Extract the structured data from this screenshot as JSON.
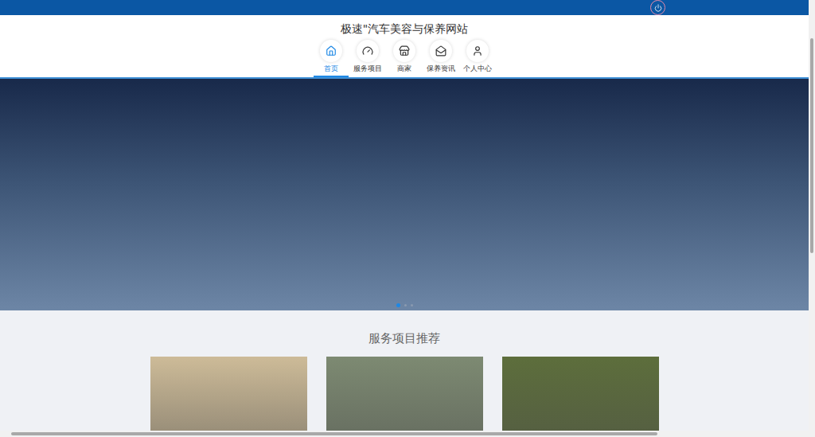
{
  "window": {
    "title": "极速\"汽车美容与保养网站"
  },
  "top_bar": {
    "logout": {
      "kind": "power"
    }
  },
  "nav": [
    {
      "label": "首页",
      "icon": "home",
      "selected": true
    },
    {
      "label": "服务项目",
      "icon": "gauge",
      "selected": false
    },
    {
      "label": "商家",
      "icon": "store",
      "selected": false
    },
    {
      "label": "保养资讯",
      "icon": "mail",
      "selected": false
    },
    {
      "label": "个人中心",
      "icon": "user",
      "selected": false
    }
  ],
  "carousel": {
    "dots": [
      {
        "selected": true
      },
      {
        "selected": false
      },
      {
        "selected": false
      }
    ]
  },
  "recommendations": {
    "title": "服务项目推荐",
    "cards": [
      {
        "color": "#cdbb98"
      },
      {
        "color": "#7d8a72"
      },
      {
        "color": "#5d6e3c"
      }
    ]
  }
}
